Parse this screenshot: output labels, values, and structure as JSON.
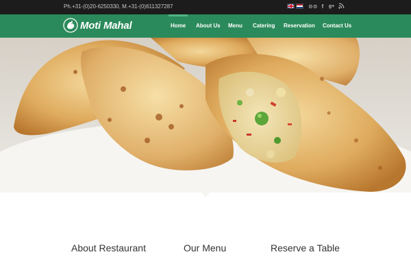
{
  "topbar": {
    "phone": "Ph.+31-(0)20-6250330, M.+31-(0)611327287",
    "languages": [
      {
        "name": "english-flag-icon"
      },
      {
        "name": "dutch-flag-icon"
      }
    ],
    "social": [
      {
        "icon": "tripadvisor-icon",
        "glyph": "⊚⊚"
      },
      {
        "icon": "facebook-icon",
        "glyph": "f"
      },
      {
        "icon": "google-plus-icon",
        "glyph": "g+"
      },
      {
        "icon": "rss-icon",
        "glyph": "⌇"
      }
    ]
  },
  "brand": {
    "name": "Moti Mahal",
    "color": "#2b8a5b"
  },
  "nav": {
    "items": [
      {
        "label": "Home",
        "active": true
      },
      {
        "label": "About Us"
      },
      {
        "label": "Menu"
      },
      {
        "label": "Catering"
      },
      {
        "label": "Reservation"
      },
      {
        "label": "Contact Us"
      }
    ]
  },
  "sections": {
    "titles": [
      "About Restaurant",
      "Our Menu",
      "Reserve a Table"
    ]
  }
}
